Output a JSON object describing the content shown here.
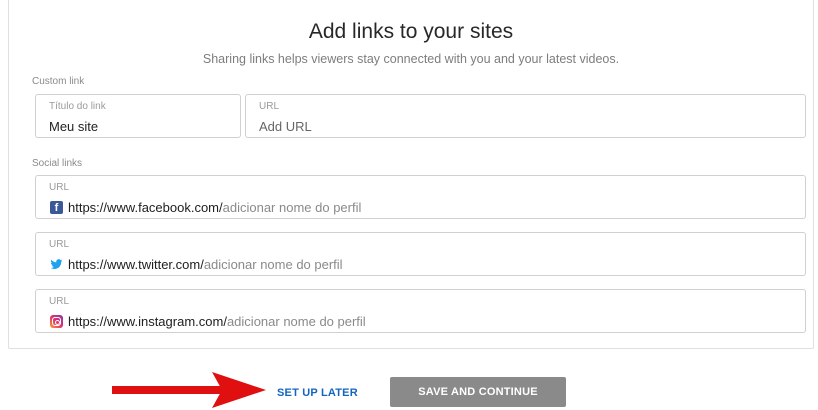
{
  "header": {
    "title": "Add links to your sites",
    "subtitle": "Sharing links helps viewers stay connected with you and your latest videos."
  },
  "custom_link": {
    "section_label": "Custom link",
    "title_field": {
      "label": "Título do link",
      "value": "Meu site"
    },
    "url_field": {
      "label": "URL",
      "placeholder": "Add URL"
    }
  },
  "social_links": {
    "section_label": "Social links",
    "items": [
      {
        "label": "URL",
        "icon": "facebook-icon",
        "prefix": "https://www.facebook.com/",
        "suffix": "adicionar nome do perfil"
      },
      {
        "label": "URL",
        "icon": "twitter-icon",
        "prefix": "https://www.twitter.com/",
        "suffix": "adicionar nome do perfil"
      },
      {
        "label": "URL",
        "icon": "instagram-icon",
        "prefix": "https://www.instagram.com/",
        "suffix": "adicionar nome do perfil"
      }
    ]
  },
  "footer": {
    "setup_later_label": "SET UP LATER",
    "save_continue_label": "SAVE AND CONTINUE"
  },
  "colors": {
    "link_blue": "#1565c0",
    "button_gray": "#8a8a8a",
    "annotation_arrow": "#e01010",
    "facebook": "#3b5998",
    "twitter": "#1da1f2"
  }
}
